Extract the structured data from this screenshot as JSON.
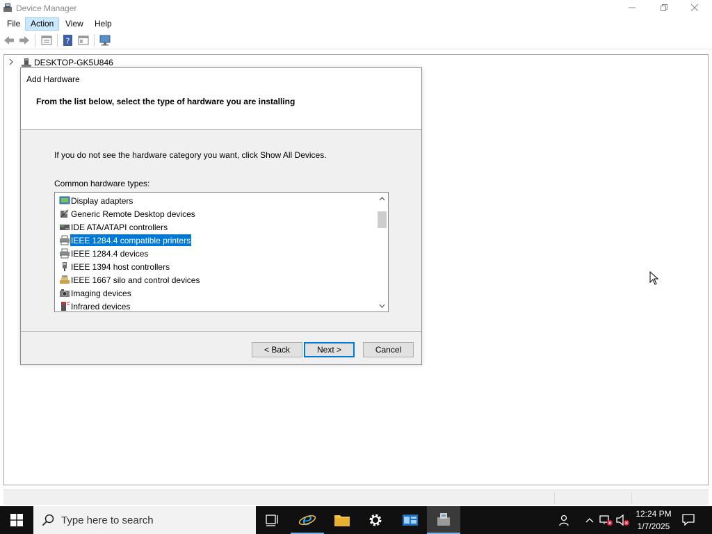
{
  "window": {
    "title": "Device Manager"
  },
  "menu": {
    "file": "File",
    "action": "Action",
    "view": "View",
    "help": "Help"
  },
  "tree": {
    "root": "DESKTOP-GK5U846"
  },
  "dialog": {
    "title": "Add Hardware",
    "heading": "From the list below, select the type of hardware you are installing",
    "info": "If you do not see the hardware category you want, click Show All Devices.",
    "list_label": "Common hardware types:",
    "items": [
      {
        "label": "Display adapters",
        "icon": "display-adapter-icon"
      },
      {
        "label": "Generic Remote Desktop devices",
        "icon": "remote-desktop-icon"
      },
      {
        "label": "IDE ATA/ATAPI controllers",
        "icon": "ide-controller-icon"
      },
      {
        "label": "IEEE 1284.4 compatible printers",
        "icon": "printer-icon",
        "selected": true
      },
      {
        "label": "IEEE 1284.4 devices",
        "icon": "printer-icon"
      },
      {
        "label": "IEEE 1394 host controllers",
        "icon": "usb-plug-icon"
      },
      {
        "label": "IEEE 1667 silo and control devices",
        "icon": "silo-device-icon"
      },
      {
        "label": "Imaging devices",
        "icon": "camera-icon"
      },
      {
        "label": "Infrared devices",
        "icon": "infrared-icon"
      }
    ],
    "back_label": "< Back",
    "next_label": "Next >",
    "cancel_label": "Cancel"
  },
  "taskbar": {
    "search_placeholder": "Type here to search",
    "time": "12:24 PM",
    "date": "1/7/2025"
  },
  "colors": {
    "selection": "#0078d7",
    "menu_highlight": "#cce8ff",
    "taskbar": "#101010"
  }
}
